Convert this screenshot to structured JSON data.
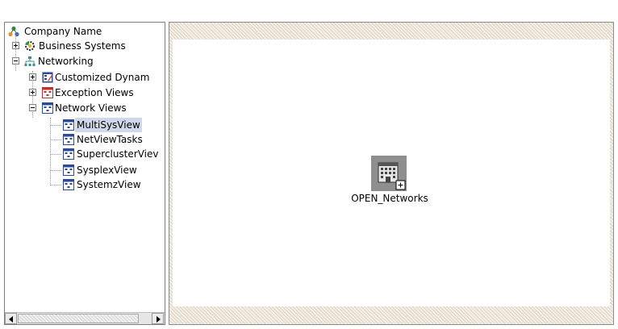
{
  "tree": {
    "root_label": "Company Name",
    "items": [
      {
        "label": "Business Systems",
        "icon": "business-systems-icon",
        "expanded": false
      },
      {
        "label": "Networking",
        "icon": "network-icon",
        "expanded": true
      },
      {
        "label": "Customized Dynam",
        "icon": "customized-view-icon",
        "expanded": false
      },
      {
        "label": "Exception Views",
        "icon": "view-folder-icon",
        "expanded": false
      },
      {
        "label": "Network Views",
        "icon": "view-folder-icon",
        "expanded": true
      },
      {
        "label": "MultiSysView",
        "icon": "view-icon",
        "selected": true
      },
      {
        "label": "NetViewTasks",
        "icon": "view-icon"
      },
      {
        "label": "SuperclusterViev",
        "icon": "view-icon"
      },
      {
        "label": "SysplexView",
        "icon": "view-icon"
      },
      {
        "label": "SystemzView",
        "icon": "view-icon"
      }
    ]
  },
  "canvas": {
    "node_label": "OPEN_Networks",
    "node_icon": "building-icon"
  },
  "colors": {
    "selection": "#cfd9ea",
    "panel_border": "#7f7f7f",
    "canvas_hatch": "#ddd3c2"
  }
}
